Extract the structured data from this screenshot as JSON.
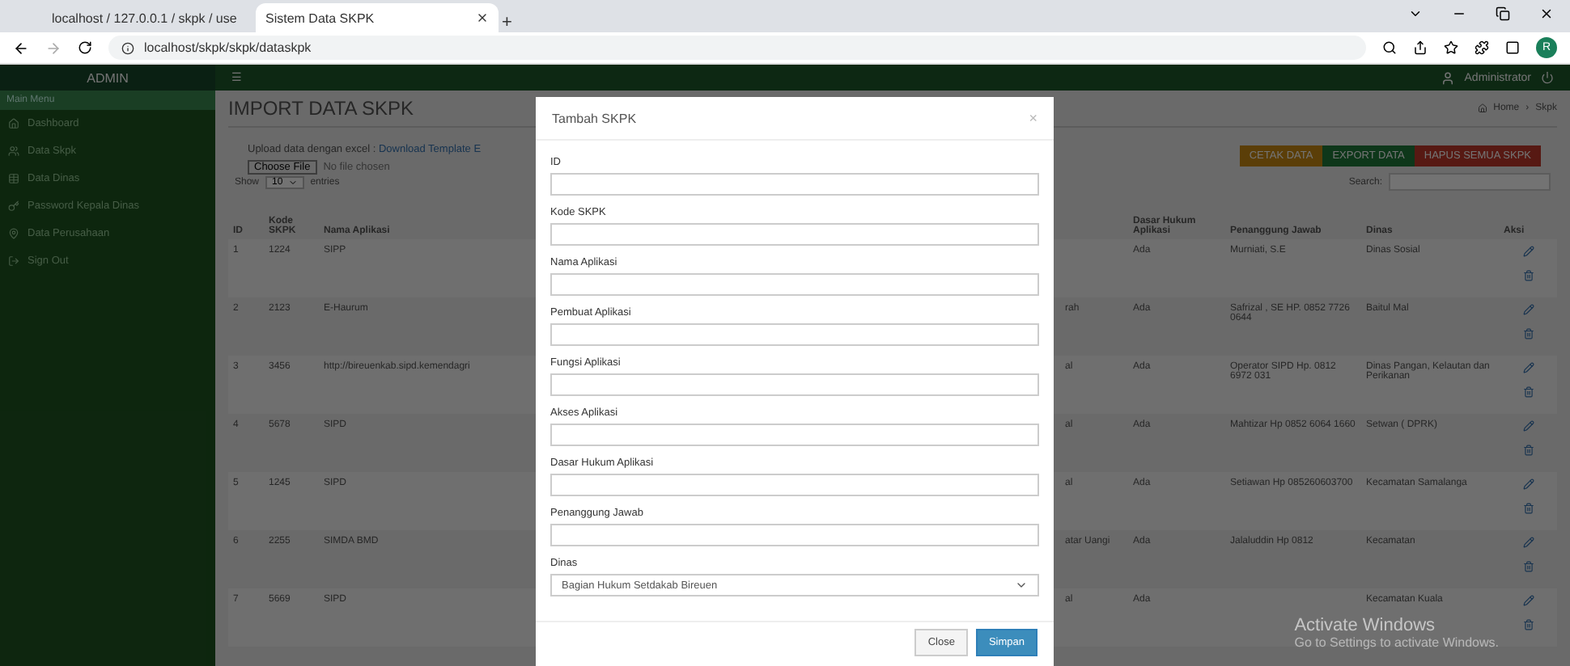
{
  "browser": {
    "tabs": [
      {
        "title": "localhost / 127.0.0.1 / skpk / use",
        "selected": false
      },
      {
        "title": "Sistem Data SKPK",
        "selected": true
      }
    ],
    "new_tab": "+",
    "url": "localhost/skpk/skpk/dataskpk",
    "profile": "R"
  },
  "header": {
    "brand": "ADMIN",
    "menu_toggle": "☰",
    "user": "Administrator"
  },
  "sidebar": {
    "heading": "Main Menu",
    "items": [
      {
        "label": "Dashboard"
      },
      {
        "label": "Data Skpk"
      },
      {
        "label": "Data Dinas"
      },
      {
        "label": "Password Kepala Dinas"
      },
      {
        "label": "Data Perusahaan"
      },
      {
        "label": "Sign Out"
      }
    ]
  },
  "page": {
    "title": "IMPORT DATA SKPK",
    "breadcrumb": [
      "Home",
      "Skpk"
    ],
    "breadcrumb_separator": "›",
    "upload": {
      "label": "Upload data dengan excel : ",
      "link": "Download Template E",
      "file_button": "Choose File",
      "file_status": "No file chosen"
    },
    "actions": [
      {
        "label": "CETAK DATA",
        "kind": "warning"
      },
      {
        "label": "EXPORT DATA",
        "kind": "success"
      },
      {
        "label": "HAPUS SEMUA SKPK",
        "kind": "danger"
      }
    ],
    "show": {
      "before": "Show",
      "value": "10",
      "after": "entries"
    },
    "search_label": "Search:",
    "table": {
      "columns": [
        "ID",
        "Kode SKPK",
        "Nama Aplikasi",
        "",
        "",
        "Dasar Hukum Aplikasi",
        "Penanggung Jawab",
        "Dinas",
        "Aksi"
      ],
      "rows": [
        [
          "1",
          "1224",
          "SIPP",
          "",
          "",
          "Ada",
          "Murniati, S.E",
          "Dinas Sosial"
        ],
        [
          "2",
          "2123",
          "E-Haurum",
          "",
          "rah",
          "Ada",
          "Safrizal , SE HP. 0852 7726 0644",
          "Baitul Mal"
        ],
        [
          "3",
          "3456",
          "http://bireuenkab.sipd.kemendagri",
          "",
          "al",
          "Ada",
          "Operator SIPD Hp. 0812 6972 031",
          "Dinas Pangan, Kelautan dan Perikanan"
        ],
        [
          "4",
          "5678",
          "SIPD",
          "",
          "al",
          "Ada",
          "Mahtizar Hp 0852 6064 1660",
          "Setwan ( DPRK)"
        ],
        [
          "5",
          "1245",
          "SIPD",
          "",
          "al",
          "Ada",
          "Setiawan Hp 085260603700",
          "Kecamatan Samalanga"
        ],
        [
          "6",
          "2255",
          "SIMDA BMD",
          "",
          "atar Uangi",
          "Ada",
          "Jalaluddin Hp 0812",
          "Kecamatan"
        ],
        [
          "7",
          "5669",
          "SIPD",
          "",
          "al",
          "Ada",
          "",
          "Kecamatan Kuala"
        ]
      ]
    }
  },
  "modal": {
    "title": "Tambah SKPK",
    "close_icon": "×",
    "fields": [
      {
        "label": "ID",
        "kind": "input"
      },
      {
        "label": "Kode SKPK",
        "kind": "input"
      },
      {
        "label": "Nama Aplikasi",
        "kind": "input"
      },
      {
        "label": "Pembuat Aplikasi",
        "kind": "input"
      },
      {
        "label": "Fungsi Aplikasi",
        "kind": "input"
      },
      {
        "label": "Akses Aplikasi",
        "kind": "input"
      },
      {
        "label": "Dasar Hukum Aplikasi",
        "kind": "input"
      },
      {
        "label": "Penanggung Jawab",
        "kind": "input"
      },
      {
        "label": "Dinas",
        "kind": "select",
        "value": "Bagian Hukum Setdakab Bireuen"
      }
    ],
    "buttons": [
      {
        "label": "Close",
        "kind": "default"
      },
      {
        "label": "Simpan",
        "kind": "primary"
      }
    ]
  },
  "os_notice": {
    "title": "Activate Windows",
    "text": "Go to Settings to activate Windows."
  }
}
